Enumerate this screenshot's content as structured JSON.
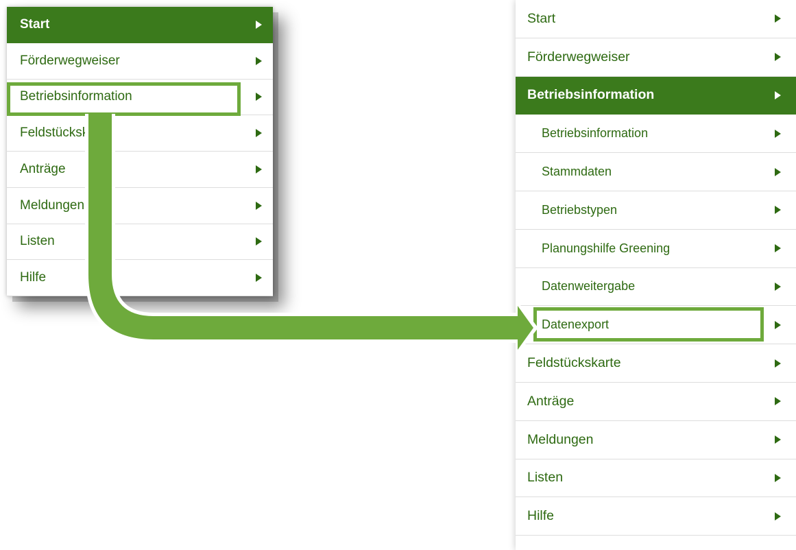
{
  "left_menu": {
    "items": [
      {
        "label": "Start",
        "active": true
      },
      {
        "label": "Förderwegweiser",
        "active": false
      },
      {
        "label": "Betriebsinformation",
        "active": false,
        "highlighted": true
      },
      {
        "label": "Feldstückskarte",
        "active": false
      },
      {
        "label": "Anträge",
        "active": false
      },
      {
        "label": "Meldungen",
        "active": false
      },
      {
        "label": "Listen",
        "active": false
      },
      {
        "label": "Hilfe",
        "active": false
      }
    ]
  },
  "right_menu": {
    "items": [
      {
        "label": "Start",
        "active": false
      },
      {
        "label": "Förderwegweiser",
        "active": false
      },
      {
        "label": "Betriebsinformation",
        "active": true,
        "expanded": true
      },
      {
        "label": "Betriebsinformation",
        "sub": true
      },
      {
        "label": "Stammdaten",
        "sub": true
      },
      {
        "label": "Betriebstypen",
        "sub": true
      },
      {
        "label": "Planungshilfe Greening",
        "sub": true
      },
      {
        "label": "Datenweitergabe",
        "sub": true
      },
      {
        "label": "Datenexport",
        "sub": true,
        "highlighted": true
      },
      {
        "label": "Feldstückskarte",
        "active": false
      },
      {
        "label": "Anträge",
        "active": false
      },
      {
        "label": "Meldungen",
        "active": false
      },
      {
        "label": "Listen",
        "active": false
      },
      {
        "label": "Hilfe",
        "active": false
      }
    ]
  },
  "icons": {
    "menu_arrow": "triangle-right-icon",
    "connector": "curved-arrow-icon"
  },
  "colors": {
    "active_bg": "#3b7a1c",
    "link_text": "#2e6a12",
    "highlight": "#6eaa3c",
    "arrow": "#6eaa3c"
  }
}
